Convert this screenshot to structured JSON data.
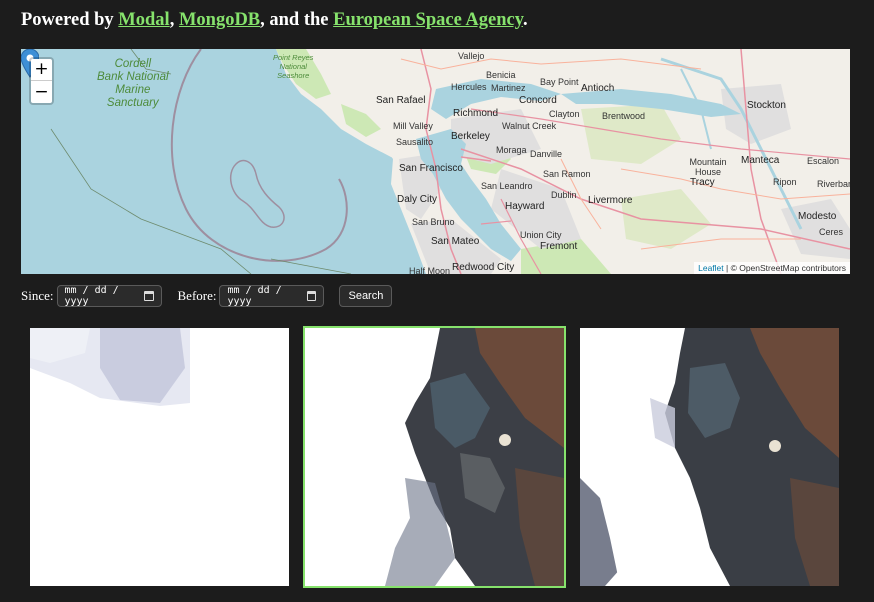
{
  "header": {
    "prefix": "Powered by ",
    "links": [
      {
        "label": "Modal"
      },
      {
        "label": "MongoDB"
      },
      {
        "label": "European Space Agency"
      }
    ],
    "sep1": ", ",
    "sep2": ", and the ",
    "suffix": "."
  },
  "map": {
    "zoom_in": "+",
    "zoom_out": "−",
    "attribution_link": "Leaflet",
    "attribution_text": " | © OpenStreetMap contributors",
    "labels": {
      "vallejo": "Vallejo",
      "benicia": "Benicia",
      "bay_point": "Bay Point",
      "antioch": "Antioch",
      "stockton": "Stockton",
      "san_rafael": "San Rafael",
      "hercules": "Hercules",
      "martinez": "Martinez",
      "concord": "Concord",
      "richmond": "Richmond",
      "brentwood": "Brentwood",
      "mill_valley": "Mill Valley",
      "clayton": "Clayton",
      "walnut_creek": "Walnut Creek",
      "sausalito": "Sausalito",
      "berkeley": "Berkeley",
      "moraga": "Moraga",
      "danville": "Danville",
      "san_francisco": "San Francisco",
      "mountain_house": "Mountain House",
      "manteca": "Manteca",
      "escalon": "Escalon",
      "san_ramon": "San Ramon",
      "san_leandro": "San Leandro",
      "tracy": "Tracy",
      "ripon": "Ripon",
      "riverbank": "Riverbank",
      "daly_city": "Daly City",
      "dublin": "Dublin",
      "livermore": "Livermore",
      "hayward": "Hayward",
      "modesto": "Modesto",
      "san_bruno": "San Bruno",
      "union_city": "Union City",
      "ceres": "Ceres",
      "san_mateo": "San Mateo",
      "fremont": "Fremont",
      "half_moon": "Half Moon",
      "redwood_city": "Redwood City",
      "cordell": "Cordell\nBank National\nMarine\nSanctuary",
      "point_reyes": "Point Reyes\nNational\nSeashore"
    }
  },
  "controls": {
    "since_label": "Since:",
    "before_label": "Before:",
    "since_value": "mm / dd / yyyy",
    "before_value": "mm / dd / yyyy",
    "search_label": "Search"
  },
  "images": [
    {
      "selected": false
    },
    {
      "selected": true
    },
    {
      "selected": false
    }
  ],
  "colors": {
    "background": "#1c1c1c",
    "link": "#86e26c",
    "water": "#aad3df",
    "land": "#f2efe9",
    "park": "#cde8b5"
  }
}
